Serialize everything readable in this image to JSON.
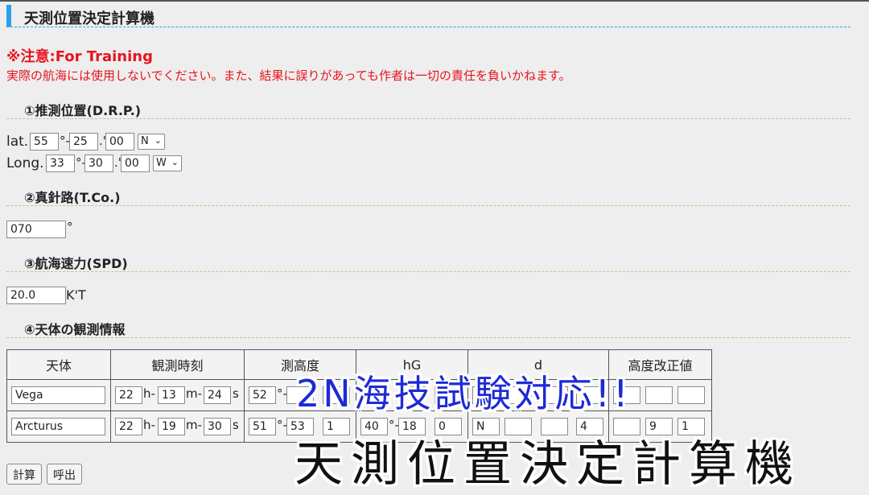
{
  "header": {
    "title": "天測位置決定計算機"
  },
  "warning": {
    "title": "※注意:For Training",
    "text": "実際の航海には使用しないでください。また、結果に誤りがあっても作者は一切の責任を負いかねます。"
  },
  "drp": {
    "heading": "①推測位置(D.R.P.)",
    "lat_label": "lat.",
    "lat_deg": "55",
    "lat_min": "25",
    "lat_dec": "00",
    "lat_hemi": "N",
    "long_label": "Long.",
    "long_deg": "33",
    "long_min": "30",
    "long_dec": "00",
    "long_hemi": "W",
    "deg_sym": "°-",
    "min_sym": ".'"
  },
  "course": {
    "heading": "②真針路(T.Co.)",
    "value": "070",
    "unit": "°"
  },
  "speed": {
    "heading": "③航海速力(SPD)",
    "value": "20.0",
    "unit": "K'T"
  },
  "observation": {
    "heading": "④天体の観測情報",
    "columns": [
      "天体",
      "観測時刻",
      "測高度",
      "hG",
      "d",
      "高度改正値"
    ],
    "rows": [
      {
        "body": "Vega",
        "h": "22",
        "m": "13",
        "s": "24",
        "alt_deg": "52",
        "alt_min": "",
        "alt_dec": "",
        "hg_deg": "",
        "hg_min": "",
        "hg_dec": "",
        "d_sign": "",
        "d_min": "",
        "d_dec": "",
        "corr_min": "",
        "corr_dec": ""
      },
      {
        "body": "Arcturus",
        "h": "22",
        "m": "19",
        "s": "30",
        "alt_deg": "51",
        "alt_min": "53",
        "alt_dec": "1",
        "hg_deg": "40",
        "hg_min": "18",
        "hg_dec": "0",
        "d_sign": "N",
        "d_min": "",
        "d_dec": "4",
        "corr_min": "9",
        "corr_dec": "1"
      }
    ],
    "time_h": "h-",
    "time_m": "m-",
    "time_s": "s",
    "deg": "°-"
  },
  "buttons": {
    "calc": "計算",
    "recall": "呼出"
  },
  "overlay": {
    "line1": "2N海技試験対応!!",
    "line2": "天測位置決定計算機"
  }
}
